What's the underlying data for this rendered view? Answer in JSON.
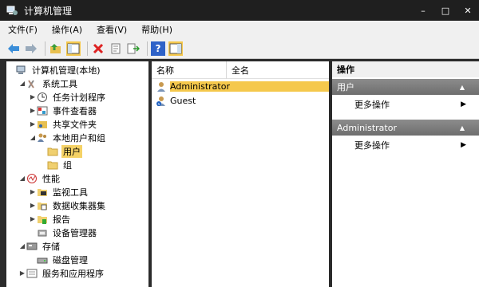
{
  "window": {
    "title": "计算机管理"
  },
  "titlebar": {
    "minimize": "–",
    "maximize": "□",
    "close": "✕"
  },
  "menu": [
    "文件(F)",
    "操作(A)",
    "查看(V)",
    "帮助(H)"
  ],
  "tree": [
    {
      "label": "计算机管理(本地)",
      "level": 0,
      "arrow": "",
      "icon": "computer-icon"
    },
    {
      "label": "系统工具",
      "level": 1,
      "arrow": "◢",
      "icon": "tools-icon"
    },
    {
      "label": "任务计划程序",
      "level": 2,
      "arrow": "▶",
      "icon": "clock-icon"
    },
    {
      "label": "事件查看器",
      "level": 2,
      "arrow": "▶",
      "icon": "event-viewer-icon"
    },
    {
      "label": "共享文件夹",
      "level": 2,
      "arrow": "▶",
      "icon": "shared-folder-icon"
    },
    {
      "label": "本地用户和组",
      "level": 2,
      "arrow": "◢",
      "icon": "users-icon"
    },
    {
      "label": "用户",
      "level": 3,
      "arrow": "",
      "icon": "folder-icon",
      "selected": true
    },
    {
      "label": "组",
      "level": 3,
      "arrow": "",
      "icon": "folder-icon"
    },
    {
      "label": "性能",
      "level": 1,
      "arrow": "◢",
      "icon": "performance-icon"
    },
    {
      "label": "监视工具",
      "level": 2,
      "arrow": "▶",
      "icon": "monitor-folder-icon"
    },
    {
      "label": "数据收集器集",
      "level": 2,
      "arrow": "▶",
      "icon": "data-collector-icon"
    },
    {
      "label": "报告",
      "level": 2,
      "arrow": "▶",
      "icon": "report-icon"
    },
    {
      "label": "设备管理器",
      "level": 2,
      "arrow": "",
      "icon": "device-manager-icon"
    },
    {
      "label": "存储",
      "level": 1,
      "arrow": "◢",
      "icon": "storage-icon"
    },
    {
      "label": "磁盘管理",
      "level": 2,
      "arrow": "",
      "icon": "disk-icon"
    },
    {
      "label": "服务和应用程序",
      "level": 1,
      "arrow": "▶",
      "icon": "services-icon"
    }
  ],
  "list": {
    "headers": [
      "名称",
      "全名"
    ],
    "rows": [
      {
        "name": "Administrator",
        "fullname": "",
        "selected": true
      },
      {
        "name": "Guest",
        "fullname": "",
        "selected": false
      }
    ]
  },
  "actions": {
    "header": "操作",
    "sections": [
      {
        "title": "用户",
        "item": "更多操作"
      },
      {
        "title": "Administrator",
        "item": "更多操作"
      }
    ]
  },
  "colors": {
    "selection": "#f5c84c",
    "titlebar": "#1f1f1f",
    "section": "#7a7a7a"
  }
}
